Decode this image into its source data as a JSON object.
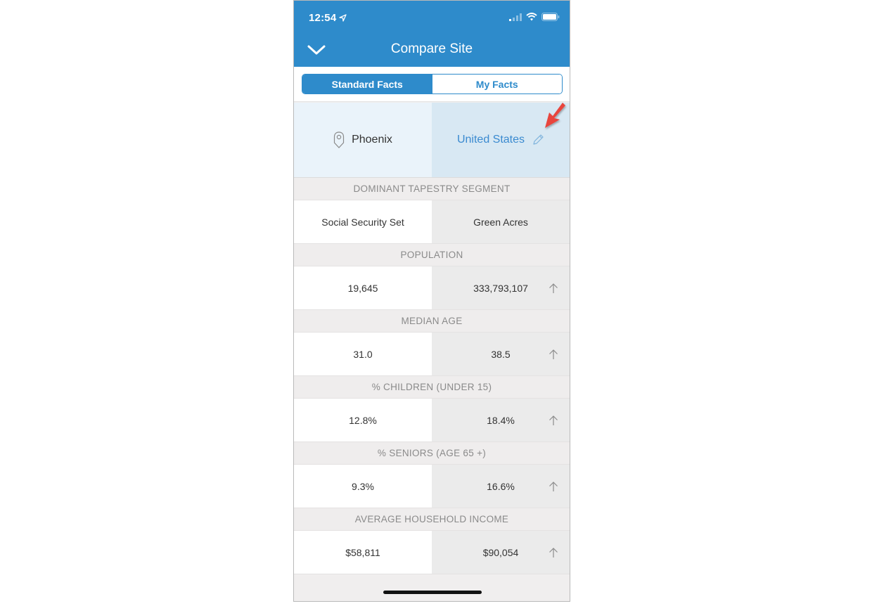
{
  "status_bar": {
    "time": "12:54",
    "icons": [
      "location-arrow-icon",
      "cellular-signal-icon",
      "wifi-icon",
      "battery-icon"
    ]
  },
  "nav": {
    "title": "Compare Site",
    "back_icon": "chevron-down-icon"
  },
  "segment": {
    "tabs": [
      {
        "label": "Standard Facts",
        "active": true
      },
      {
        "label": "My Facts",
        "active": false
      }
    ]
  },
  "sites": {
    "left": {
      "name": "Phoenix",
      "icon": "map-pin-icon"
    },
    "right": {
      "name": "United States",
      "icon": "pencil-icon"
    }
  },
  "facts": [
    {
      "label": "DOMINANT TAPESTRY SEGMENT",
      "left": "Social Security Set",
      "right": "Green Acres",
      "trend": ""
    },
    {
      "label": "POPULATION",
      "left": "19,645",
      "right": "333,793,107",
      "trend": "up"
    },
    {
      "label": "MEDIAN AGE",
      "left": "31.0",
      "right": "38.5",
      "trend": "up"
    },
    {
      "label": "% CHILDREN (UNDER 15)",
      "left": "12.8%",
      "right": "18.4%",
      "trend": "up"
    },
    {
      "label": "% SENIORS (AGE 65 +)",
      "left": "9.3%",
      "right": "16.6%",
      "trend": "up"
    },
    {
      "label": "AVERAGE HOUSEHOLD INCOME",
      "left": "$58,811",
      "right": "$90,054",
      "trend": "up"
    }
  ],
  "colors": {
    "brand_blue": "#2e8bcb",
    "link_blue": "#3a8ad0",
    "annotation_red": "#e8453c"
  }
}
